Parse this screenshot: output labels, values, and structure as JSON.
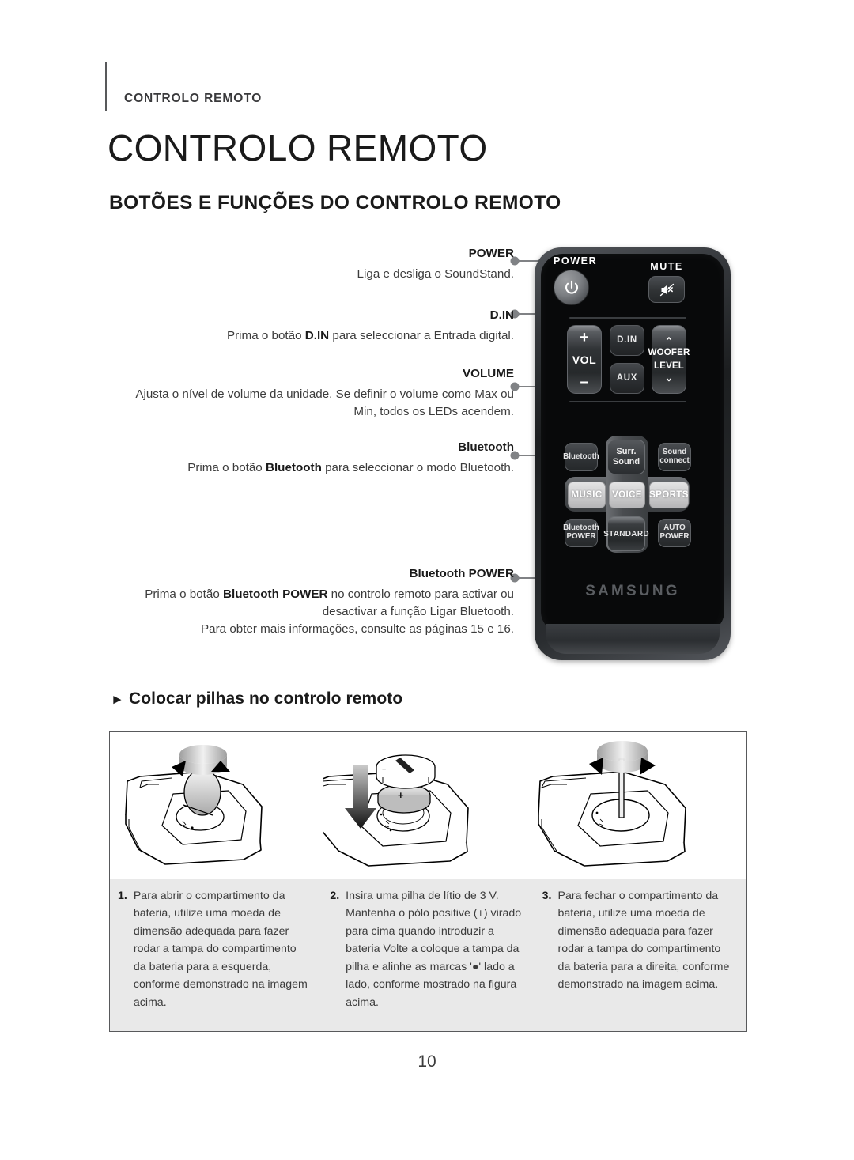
{
  "header": {
    "breadcrumb": "CONTROLO REMOTO",
    "page_title": "CONTROLO REMOTO",
    "section_title": "BOTÕES E FUNÇÕES DO CONTROLO REMOTO"
  },
  "callouts": [
    {
      "label": "POWER",
      "desc_html": "Liga e desliga o SoundStand."
    },
    {
      "label": "D.IN",
      "desc_html": "Prima o botão <b>D.IN</b> para seleccionar a Entrada digital."
    },
    {
      "label": "VOLUME",
      "desc_html": "Ajusta o nível de volume da unidade. Se definir o volume como Max ou Min, todos os LEDs acendem."
    },
    {
      "label": "Bluetooth",
      "desc_html": "Prima o botão <b>Bluetooth</b> para seleccionar o modo Bluetooth."
    },
    {
      "label": "Bluetooth POWER",
      "desc_html": "Prima o botão <b>Bluetooth POWER</b> no controlo remoto para activar ou desactivar a função Ligar Bluetooth.<br>Para obter mais informações, consulte as páginas 15 e 16."
    }
  ],
  "remote": {
    "brand": "SAMSUNG",
    "labels": {
      "power": "POWER",
      "mute": "MUTE"
    },
    "buttons": {
      "vol_plus": "+",
      "vol_text": "VOL",
      "vol_minus": "–",
      "din": "D.IN",
      "aux": "AUX",
      "woofer_up": "⌃",
      "woofer_line1": "WOOFER",
      "woofer_line2": "LEVEL",
      "woofer_down": "⌄",
      "bluetooth": "Bluetooth",
      "surr_line1": "Surr.",
      "surr_line2": "Sound",
      "sound_connect_line1": "Sound",
      "sound_connect_line2": "connect",
      "music": "MUSIC",
      "voice": "VOICE",
      "sports": "SPORTS",
      "bluetooth_power_line1": "Bluetooth",
      "bluetooth_power_line2": "POWER",
      "standard": "STANDARD",
      "auto_power_line1": "AUTO",
      "auto_power_line2": "POWER"
    }
  },
  "battery": {
    "heading": "Colocar pilhas no controlo remoto",
    "heading_arrow": "►",
    "steps": [
      {
        "number": "1.",
        "text": "Para abrir o compartimento da bateria, utilize uma moeda de dimensão adequada para fazer rodar a tampa do compartimento da bateria para a esquerda, conforme demonstrado na imagem acima."
      },
      {
        "number": "2.",
        "text": "Insira uma pilha de lítio de 3 V. Mantenha o pólo positive (+) virado para cima quando introduzir a bateria Volte a coloque a tampa da pilha e alinhe as marcas '●' lado a lado, conforme mostrado na figura acima."
      },
      {
        "number": "3.",
        "text": "Para fechar o compartimento da bateria, utilize uma moeda de dimensão adequada para fazer rodar a tampa do compartimento da bateria para a direita, conforme demonstrado na imagem acima."
      }
    ]
  },
  "footer": {
    "page_number": "10"
  },
  "colors": {
    "text": "#231f20",
    "rule": "#58595b",
    "panel_bg": "#e9e9e9",
    "remote_body": "#08090a"
  }
}
